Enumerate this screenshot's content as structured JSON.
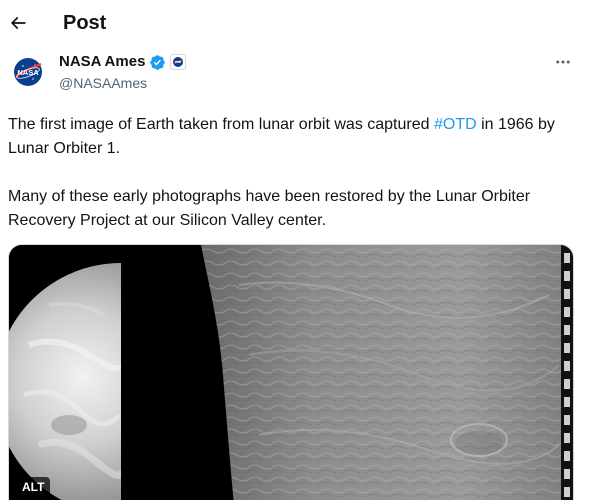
{
  "header": {
    "title": "Post",
    "back_icon": "arrow-left-icon"
  },
  "author": {
    "display_name": "NASA Ames",
    "handle": "@NASAAmes",
    "avatar_logo_text": "NASA",
    "verified": true,
    "verified_color": "#1d9bf0"
  },
  "tweet": {
    "text_before_hashtag": "The first image of Earth taken from lunar orbit was captured ",
    "hashtag": "#OTD",
    "text_after_hashtag": " in 1966 by Lunar Orbiter 1.",
    "paragraph2": "Many of these early photographs have been restored by the Lunar Orbiter Recovery Project at our Silicon Valley center."
  },
  "media": {
    "alt_badge": "ALT"
  },
  "colors": {
    "link": "#1d9bf0",
    "secondary_text": "#536471",
    "primary_text": "#0f1419"
  }
}
